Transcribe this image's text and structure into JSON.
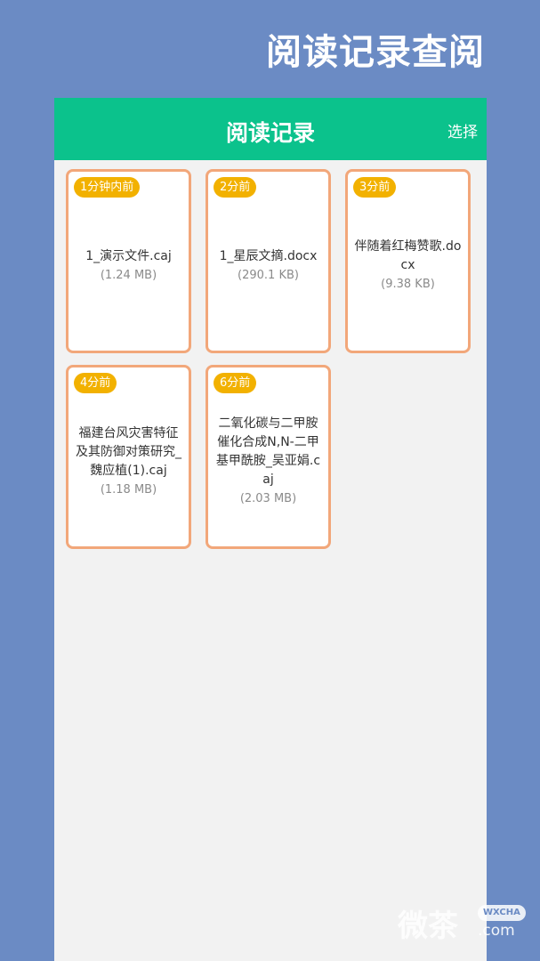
{
  "promo": {
    "title": "阅读记录查阅"
  },
  "header": {
    "title": "阅读记录",
    "select_label": "选择"
  },
  "records": [
    {
      "time": "1分钟内前",
      "name": "1_演示文件.caj",
      "size": "(1.24 MB)"
    },
    {
      "time": "2分前",
      "name": "1_星辰文摘.docx",
      "size": "(290.1 KB)"
    },
    {
      "time": "3分前",
      "name": "伴随着红梅赞歌.docx",
      "size": "(9.38 KB)"
    },
    {
      "time": "4分前",
      "name": "福建台风灾害特征及其防御对策研究_魏应植(1).caj",
      "size": "(1.18 MB)"
    },
    {
      "time": "6分前",
      "name": "二氧化碳与二甲胺催化合成N,N-二甲基甲酰胺_吴亚娟.caj",
      "size": "(2.03 MB)"
    }
  ],
  "watermark": {
    "text": "微茶",
    "tag": "WXCHA",
    "domain": ".com"
  },
  "colors": {
    "background": "#6b8bc4",
    "header": "#0bc28c",
    "card_border": "#f2a77a",
    "badge": "#f2b100"
  }
}
